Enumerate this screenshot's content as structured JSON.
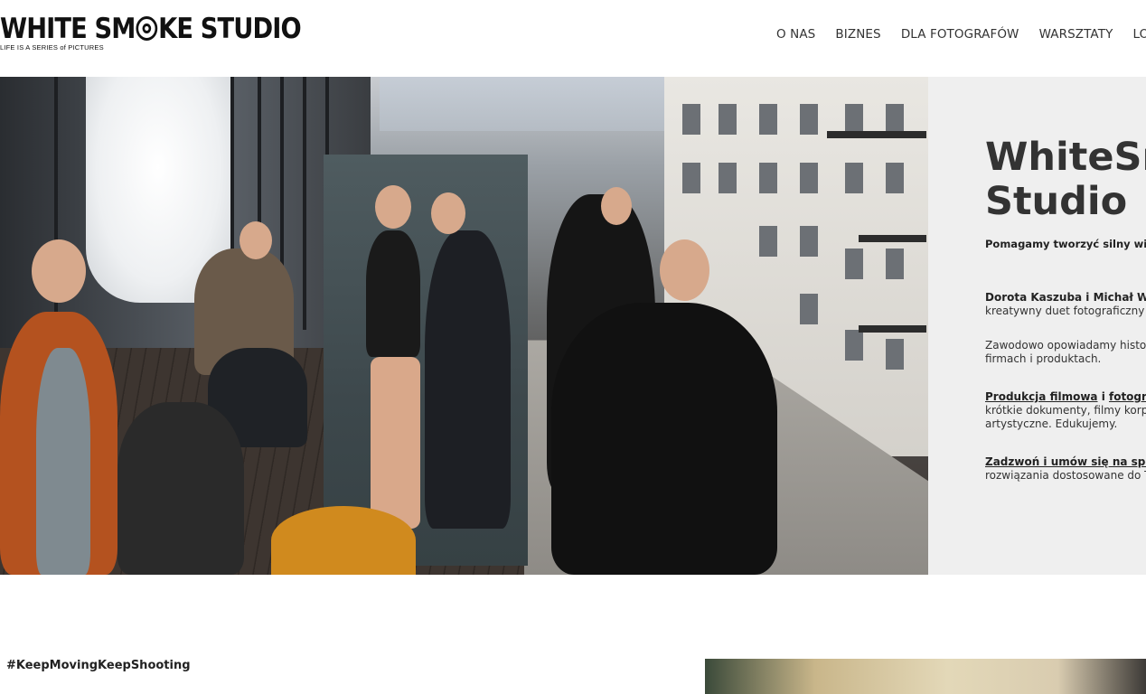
{
  "header": {
    "logo_text_part1": "WHITE SM",
    "logo_text_part2": "KE STUDIO",
    "logo_tagline": "LIFE IS A SERIES of PICTURES",
    "nav": [
      "O NAS",
      "BIZNES",
      "DLA FOTOGRAFÓW",
      "WARSZTATY",
      "LOVE"
    ]
  },
  "hero": {
    "title_line1": "WhiteSmoke",
    "title_line2": "Studio",
    "subtitle": "Pomagamy tworzyć silny wizerunek",
    "p1_bold": "Dorota Kaszuba i Michał Wr",
    "p1_rest": "kreatywny duet fotograficzny",
    "p2_line1": "Zawodowo opowiadamy historie o",
    "p2_line2": "firmach i produktach.",
    "p3_link1": "Produkcja filmowa",
    "p3_and": " i ",
    "p3_link2": "fotografia",
    "p3_line2": "krótkie dokumenty, filmy korporacyjne",
    "p3_line3": "artystyczne. Edukujemy.",
    "p4_link": "Zadzwoń i umów się na spotkanie",
    "p4_line2": "rozwiązania dostosowane do Twoich"
  },
  "section": {
    "hashtag": "#KeepMovingKeepShooting"
  }
}
